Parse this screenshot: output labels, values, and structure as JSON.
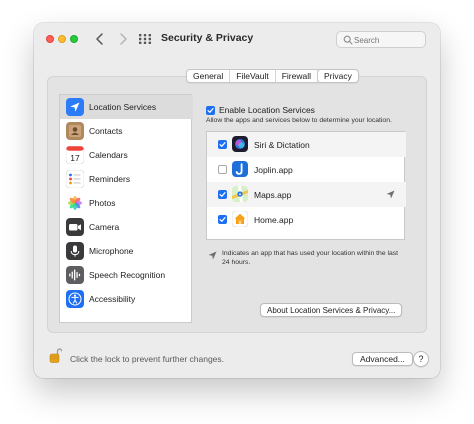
{
  "window": {
    "title": "Security & Privacy",
    "search_placeholder": "Search"
  },
  "tabs": [
    {
      "label": "General",
      "active": false
    },
    {
      "label": "FileVault",
      "active": false
    },
    {
      "label": "Firewall",
      "active": false
    },
    {
      "label": "Privacy",
      "active": true
    }
  ],
  "sidebar": {
    "items": [
      {
        "label": "Location Services",
        "icon": "location-services-icon",
        "selected": true
      },
      {
        "label": "Contacts",
        "icon": "contacts-icon",
        "selected": false
      },
      {
        "label": "Calendars",
        "icon": "calendar-icon",
        "selected": false
      },
      {
        "label": "Reminders",
        "icon": "reminders-icon",
        "selected": false
      },
      {
        "label": "Photos",
        "icon": "photos-icon",
        "selected": false
      },
      {
        "label": "Camera",
        "icon": "camera-icon",
        "selected": false
      },
      {
        "label": "Microphone",
        "icon": "microphone-icon",
        "selected": false
      },
      {
        "label": "Speech Recognition",
        "icon": "speech-recognition-icon",
        "selected": false
      },
      {
        "label": "Accessibility",
        "icon": "accessibility-icon",
        "selected": false
      }
    ],
    "calendar_day": "17"
  },
  "location": {
    "enable_label": "Enable Location Services",
    "enable_checked": true,
    "description": "Allow the apps and services below to determine your location.",
    "apps": [
      {
        "label": "Siri & Dictation",
        "checked": true,
        "icon": "siri-icon",
        "recent": false
      },
      {
        "label": "Joplin.app",
        "checked": false,
        "icon": "joplin-icon",
        "recent": false
      },
      {
        "label": "Maps.app",
        "checked": true,
        "icon": "maps-icon",
        "recent": true
      },
      {
        "label": "Home.app",
        "checked": true,
        "icon": "home-icon",
        "recent": false
      }
    ],
    "note": "Indicates an app that has used your location within the last 24 hours.",
    "about_button": "About Location Services & Privacy..."
  },
  "footer": {
    "lock_text": "Click the lock to prevent further changes.",
    "advanced_button": "Advanced...",
    "help_button": "?"
  },
  "colors": {
    "accent": "#1f6ff2",
    "close": "#ff5f57",
    "minimize": "#febc2e",
    "zoom": "#28c840"
  }
}
